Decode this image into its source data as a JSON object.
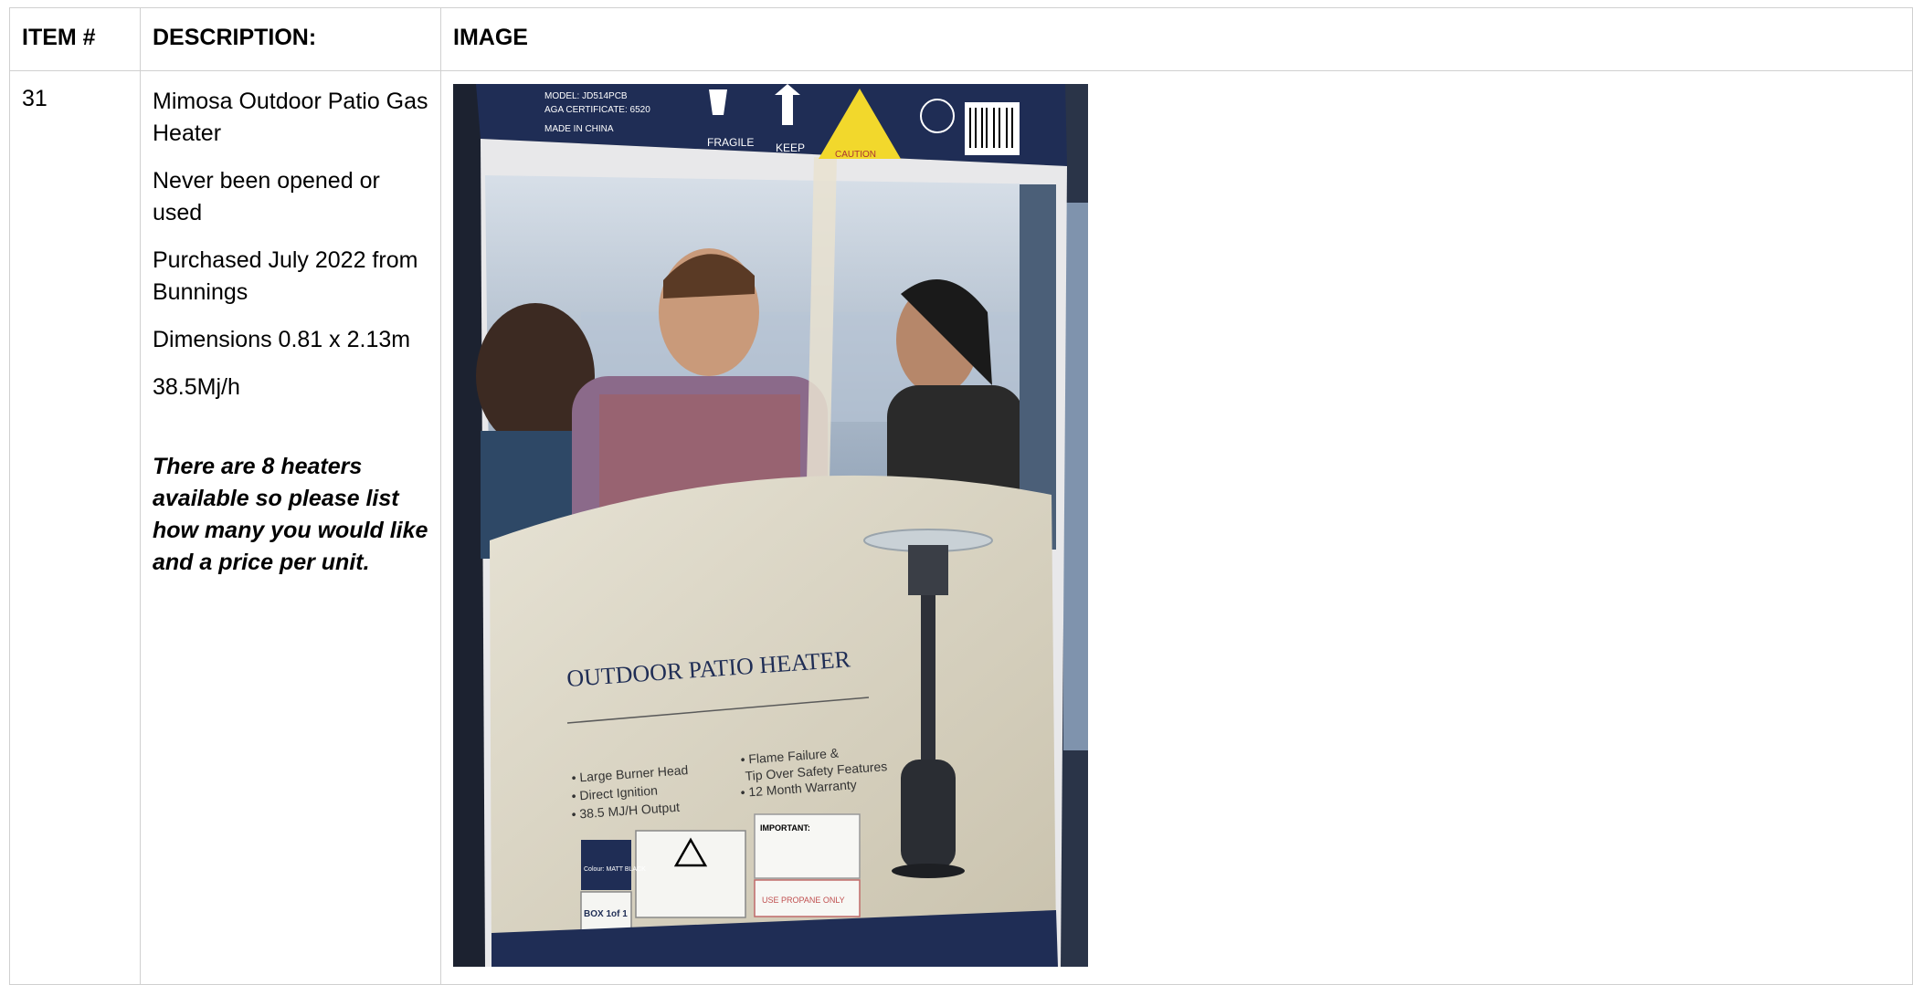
{
  "headers": {
    "item": "ITEM #",
    "description": "DESCRIPTION:",
    "image": "IMAGE"
  },
  "item": {
    "number": "31",
    "lines": [
      "Mimosa Outdoor Patio Gas Heater",
      "Never been opened or used",
      "Purchased July 2022 from Bunnings",
      "Dimensions 0.81 x 2.13m",
      "38.5Mj/h"
    ],
    "note": "There are 8 heaters available so please list how many you would like and a price per unit."
  },
  "photo": {
    "top_label_lines": [
      "MODEL: JD514PCB",
      "AGA CERTIFICATE: 6520",
      "MADE IN CHINA"
    ],
    "fragile": "FRAGILE",
    "keep": "KEEP",
    "caution": "CAUTION",
    "product_title": "OUTDOOR PATIO HEATER",
    "features_left": [
      "• Large Burner Head",
      "• Direct Ignition",
      "• 38.5 MJ/H Output"
    ],
    "features_right": [
      "• Flame Failure &",
      "Tip Over Safety Features",
      "• 12 Month Warranty"
    ],
    "colour_label": "Colour: MATT BLACK",
    "box_label": "BOX 1of 1",
    "important_title": "IMPORTANT:",
    "gas_type": "USE PROPANE ONLY"
  }
}
